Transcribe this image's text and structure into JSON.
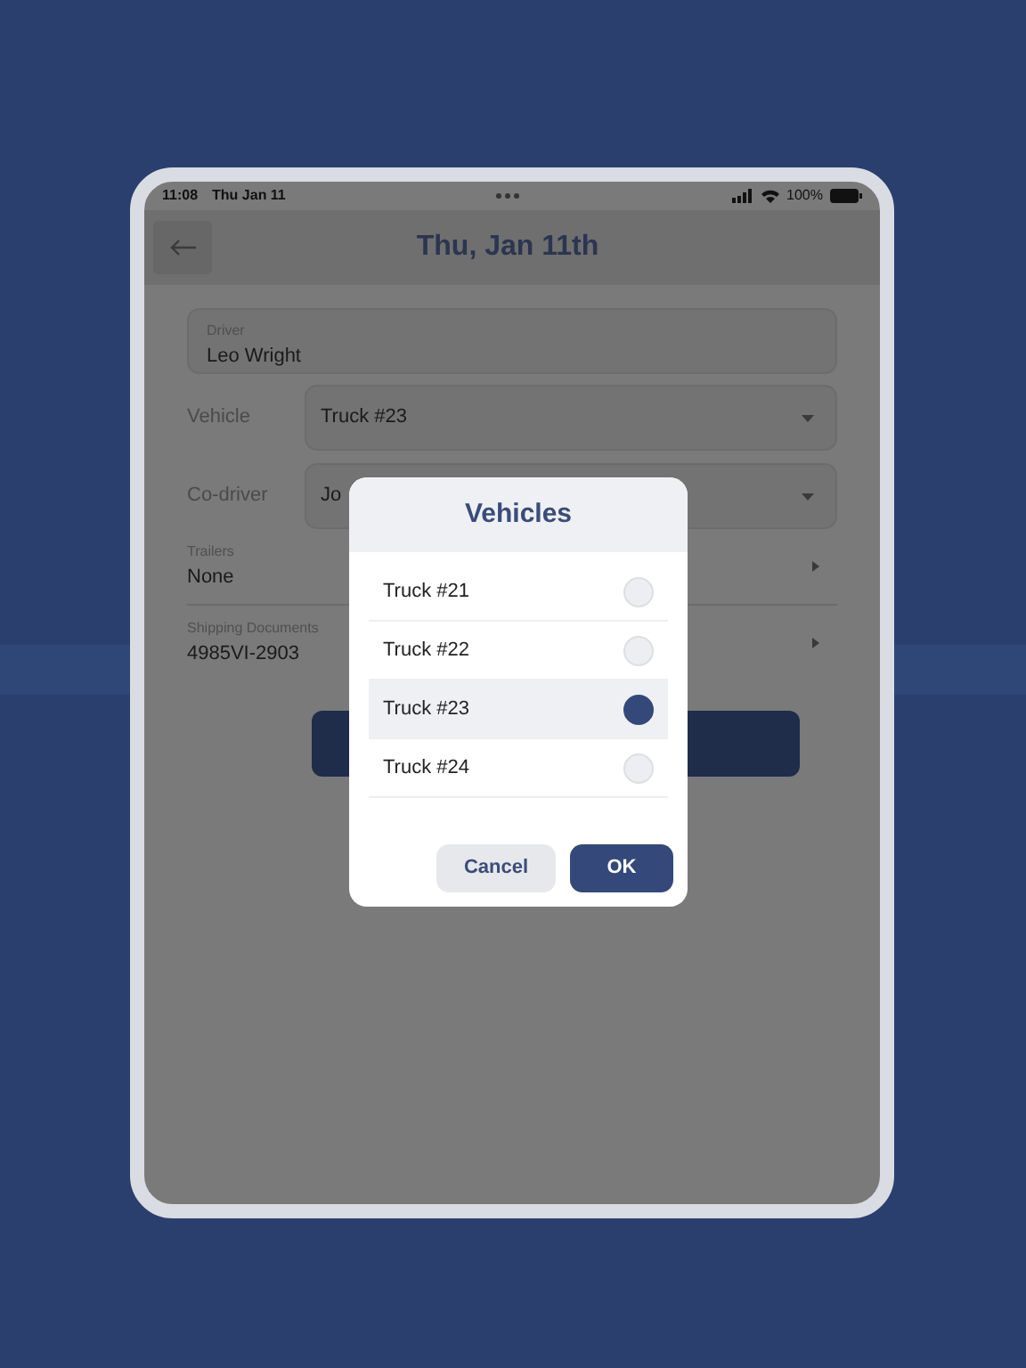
{
  "status_bar": {
    "time": "11:08",
    "date": "Thu Jan 11",
    "battery": "100%"
  },
  "header": {
    "title": "Thu, Jan 11th"
  },
  "form": {
    "driver": {
      "label": "Driver",
      "value": "Leo Wright"
    },
    "vehicle": {
      "label": "Vehicle",
      "value": "Truck #23"
    },
    "co_driver": {
      "label": "Co-driver",
      "value": "Jo"
    },
    "trailers": {
      "label": "Trailers",
      "value": "None"
    },
    "shipping_documents": {
      "label": "Shipping Documents",
      "value": "4985VI-2903"
    }
  },
  "dialog": {
    "title": "Vehicles",
    "options": [
      {
        "label": "Truck #21",
        "selected": false
      },
      {
        "label": "Truck #22",
        "selected": false
      },
      {
        "label": "Truck #23",
        "selected": true
      },
      {
        "label": "Truck #24",
        "selected": false
      }
    ],
    "buttons": [
      {
        "label": "Cancel",
        "kind": "secondary"
      },
      {
        "label": "OK",
        "kind": "primary"
      }
    ]
  }
}
